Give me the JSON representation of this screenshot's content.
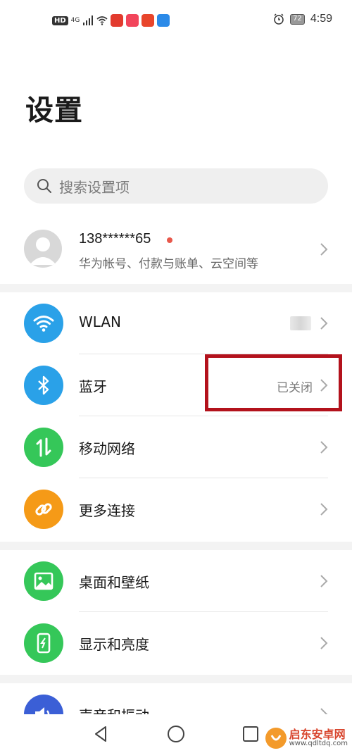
{
  "status_bar": {
    "hd": "HD",
    "signal": "4G",
    "battery": "72",
    "time": "4:59",
    "app_colors": [
      "#e23b2e",
      "#f2455b",
      "#e8452b",
      "#2b8ae8"
    ]
  },
  "page": {
    "title": "设置"
  },
  "search": {
    "placeholder": "搜索设置项"
  },
  "account": {
    "name": "138******65",
    "subtitle": "华为帐号、付款与账单、云空间等"
  },
  "settings": [
    {
      "label": "WLAN",
      "value": "",
      "icon": "wifi-icon",
      "color": "#2aa1e8"
    },
    {
      "label": "蓝牙",
      "value": "已关闭",
      "icon": "bluetooth-icon",
      "color": "#2aa1e8"
    },
    {
      "label": "移动网络",
      "value": "",
      "icon": "mobile-data-icon",
      "color": "#35c759"
    },
    {
      "label": "更多连接",
      "value": "",
      "icon": "link-icon",
      "color": "#f59a17"
    },
    {
      "label": "桌面和壁纸",
      "value": "",
      "icon": "wallpaper-icon",
      "color": "#35c759"
    },
    {
      "label": "显示和亮度",
      "value": "",
      "icon": "display-icon",
      "color": "#35c759"
    },
    {
      "label": "声音和振动",
      "value": "",
      "icon": "sound-icon",
      "color": "#3b5fd6"
    }
  ],
  "watermark": {
    "title": "启东安卓网",
    "url": "www.qdltdq.com"
  }
}
